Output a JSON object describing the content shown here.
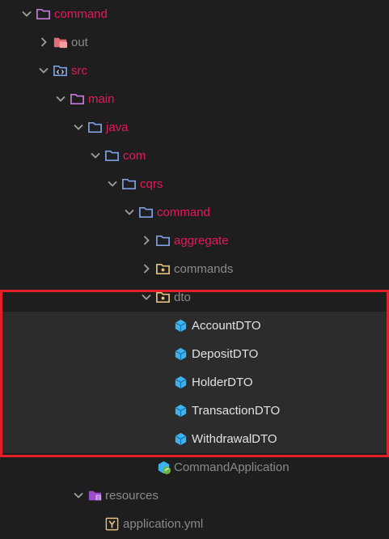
{
  "tree": {
    "root": {
      "label": "command",
      "icon": "folder-open-icon",
      "expanded": true
    },
    "out": {
      "label": "out",
      "icon": "folder-out-icon",
      "expanded": false
    },
    "src": {
      "label": "src",
      "icon": "folder-src-icon",
      "expanded": true
    },
    "main": {
      "label": "main",
      "icon": "folder-open-icon",
      "expanded": true
    },
    "java": {
      "label": "java",
      "icon": "folder-open-icon",
      "expanded": true
    },
    "com": {
      "label": "com",
      "icon": "folder-open-icon",
      "expanded": true
    },
    "cqrs": {
      "label": "cqrs",
      "icon": "folder-open-icon",
      "expanded": true
    },
    "command_pkg": {
      "label": "command",
      "icon": "folder-open-icon",
      "expanded": true
    },
    "aggregate": {
      "label": "aggregate",
      "icon": "folder-icon",
      "expanded": false
    },
    "commands": {
      "label": "commands",
      "icon": "package-folder-icon",
      "expanded": false
    },
    "dto": {
      "label": "dto",
      "icon": "package-folder-icon",
      "expanded": true
    },
    "dto_files": [
      {
        "label": "AccountDTO",
        "icon": "class-cube-icon"
      },
      {
        "label": "DepositDTO",
        "icon": "class-cube-icon"
      },
      {
        "label": "HolderDTO",
        "icon": "class-cube-icon"
      },
      {
        "label": "TransactionDTO",
        "icon": "class-cube-icon"
      },
      {
        "label": "WithdrawalDTO",
        "icon": "class-cube-icon"
      }
    ],
    "command_application": {
      "label": "CommandApplication",
      "icon": "spring-app-icon"
    },
    "resources": {
      "label": "resources",
      "icon": "resources-folder-icon",
      "expanded": true
    },
    "application_yml": {
      "label": "application.yml",
      "icon": "yaml-file-icon"
    }
  },
  "colors": {
    "background": "#1e1e1e",
    "selection": "#2c2c2c",
    "highlight_border": "#e0212a",
    "folder_label": "#e8175d",
    "muted_label": "#8a8a8a",
    "file_label": "#e2e2e2",
    "folder_icon": "#7e9fe3",
    "root_folder_icon": "#c678dd",
    "class_icon": "#3db2f0"
  }
}
